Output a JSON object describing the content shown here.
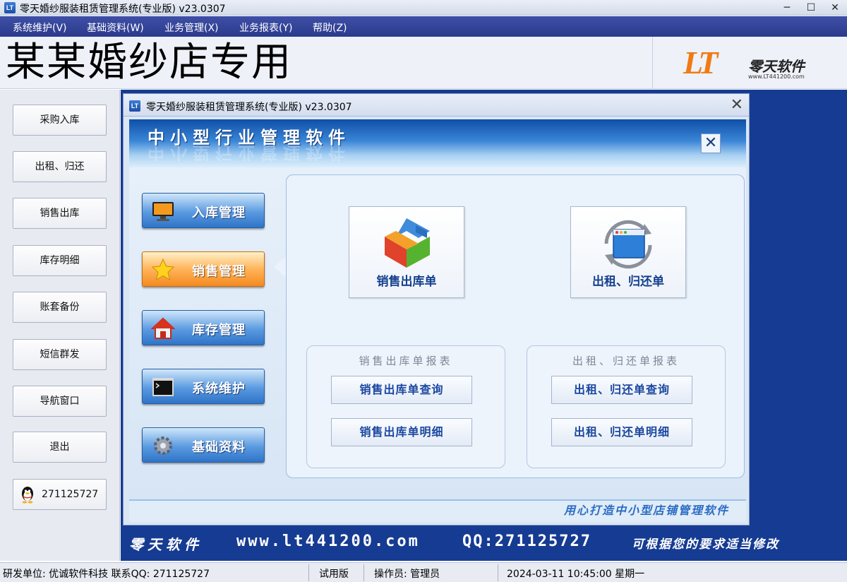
{
  "window": {
    "title": "零天婚纱服装租赁管理系统(专业版)  v23.0307",
    "minimize": "─",
    "maximize": "☐",
    "close": "✕"
  },
  "menu": [
    {
      "label": "系统维护(V)"
    },
    {
      "label": "基础资料(W)"
    },
    {
      "label": "业务管理(X)"
    },
    {
      "label": "业务报表(Y)"
    },
    {
      "label": "帮助(Z)"
    }
  ],
  "header": {
    "shop_name": "某某婚纱店专用",
    "logo_letters": "LT",
    "logo_brand": "零天软件",
    "logo_url": "www.LT441200.com"
  },
  "sidebar": [
    {
      "label": "采购入库"
    },
    {
      "label": "出租、归还"
    },
    {
      "label": "销售出库"
    },
    {
      "label": "库存明细"
    },
    {
      "label": "账套备份"
    },
    {
      "label": "短信群发"
    },
    {
      "label": "导航窗口"
    },
    {
      "label": "退出"
    },
    {
      "label": "271125727"
    }
  ],
  "inner_window": {
    "title": "零天婚纱服装租赁管理系统(专业版)  v23.0307",
    "close": "✕",
    "banner_slogan": "中小型行业管理软件",
    "banner_close": "✕"
  },
  "categories": [
    {
      "label": "入库管理",
      "icon": "monitor-icon",
      "active": false
    },
    {
      "label": "销售管理",
      "icon": "star-icon",
      "active": true
    },
    {
      "label": "库存管理",
      "icon": "home-icon",
      "active": false
    },
    {
      "label": "系统维护",
      "icon": "terminal-icon",
      "active": false
    },
    {
      "label": "基础资料",
      "icon": "gear-icon",
      "active": false
    }
  ],
  "big_buttons": [
    {
      "label": "销售出库单",
      "icon": "puzzle-icon"
    },
    {
      "label": "出租、归还单",
      "icon": "refresh-window-icon"
    }
  ],
  "groups": [
    {
      "title": "销售出库单报表",
      "buttons": [
        "销售出库单查询",
        "销售出库单明细"
      ]
    },
    {
      "title": "出租、归还单报表",
      "buttons": [
        "出租、归还单查询",
        "出租、归还单明细"
      ]
    }
  ],
  "tagline": "用心打造中小型店铺管理软件",
  "info_line": {
    "brand": "零天软件",
    "url": "www.lt441200.com",
    "qq": "QQ:271125727",
    "note": "可根据您的要求适当修改"
  },
  "statusbar": {
    "developer": "研发单位: 优诚软件科技  联系QQ: 271125727",
    "edition": "试用版",
    "operator": "操作员: 管理员",
    "datetime": "2024-03-11 10:45:00 星期一"
  },
  "colors": {
    "menubar": "#2b3a8c",
    "workspace": "#163b92",
    "active_category": "#f48a20",
    "category": "#2f74c8",
    "link_text": "#1b47a0"
  }
}
